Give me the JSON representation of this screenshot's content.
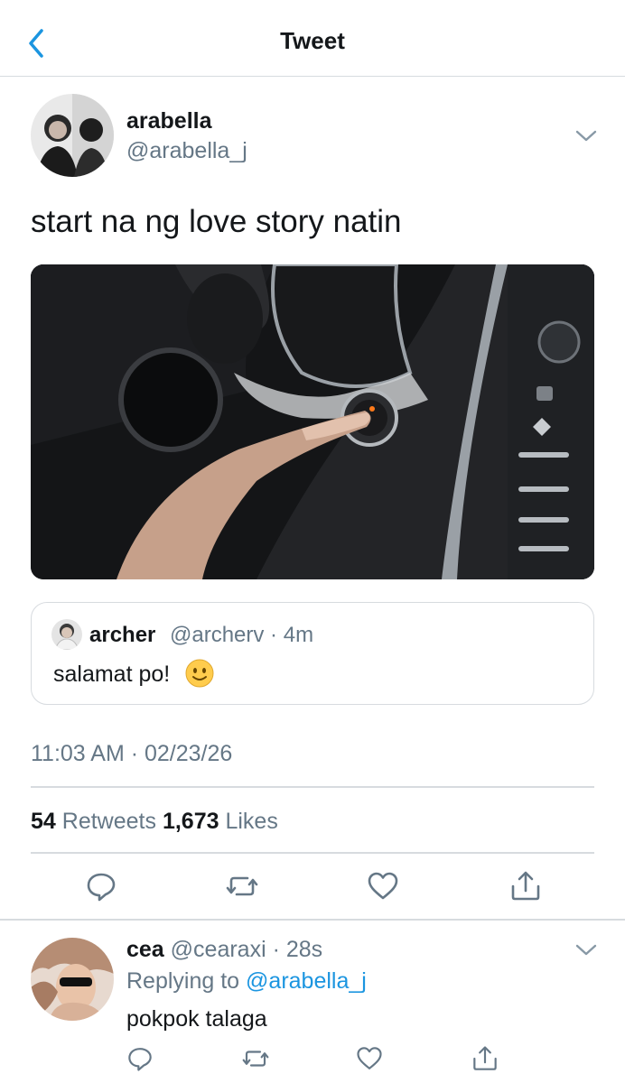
{
  "header": {
    "title": "Tweet",
    "back_icon": "chevron-left-icon",
    "accent": "#1b95e0"
  },
  "tweet": {
    "display_name": "arabella",
    "handle": "@arabella_j",
    "text": "start na ng love story natin",
    "media_description_icon": "car-start-button-photo",
    "quoted": {
      "display_name": "archer",
      "handle_time": "@archerv · 4m",
      "text": "salamat po!",
      "emoji": "slightly-smiling-face"
    },
    "timestamp": "11:03 AM · 02/23/26",
    "retweets_count": "54",
    "retweets_label": "Retweets",
    "likes_count": "1,673",
    "likes_label": "Likes"
  },
  "actions": [
    "reply-icon",
    "retweet-icon",
    "like-icon",
    "share-icon"
  ],
  "reply": {
    "display_name": "cea",
    "handle_time": "@cearaxi · 28s",
    "replying_prefix": "Replying to",
    "replying_to": "@arabella_j",
    "text": "pokpok talaga"
  }
}
